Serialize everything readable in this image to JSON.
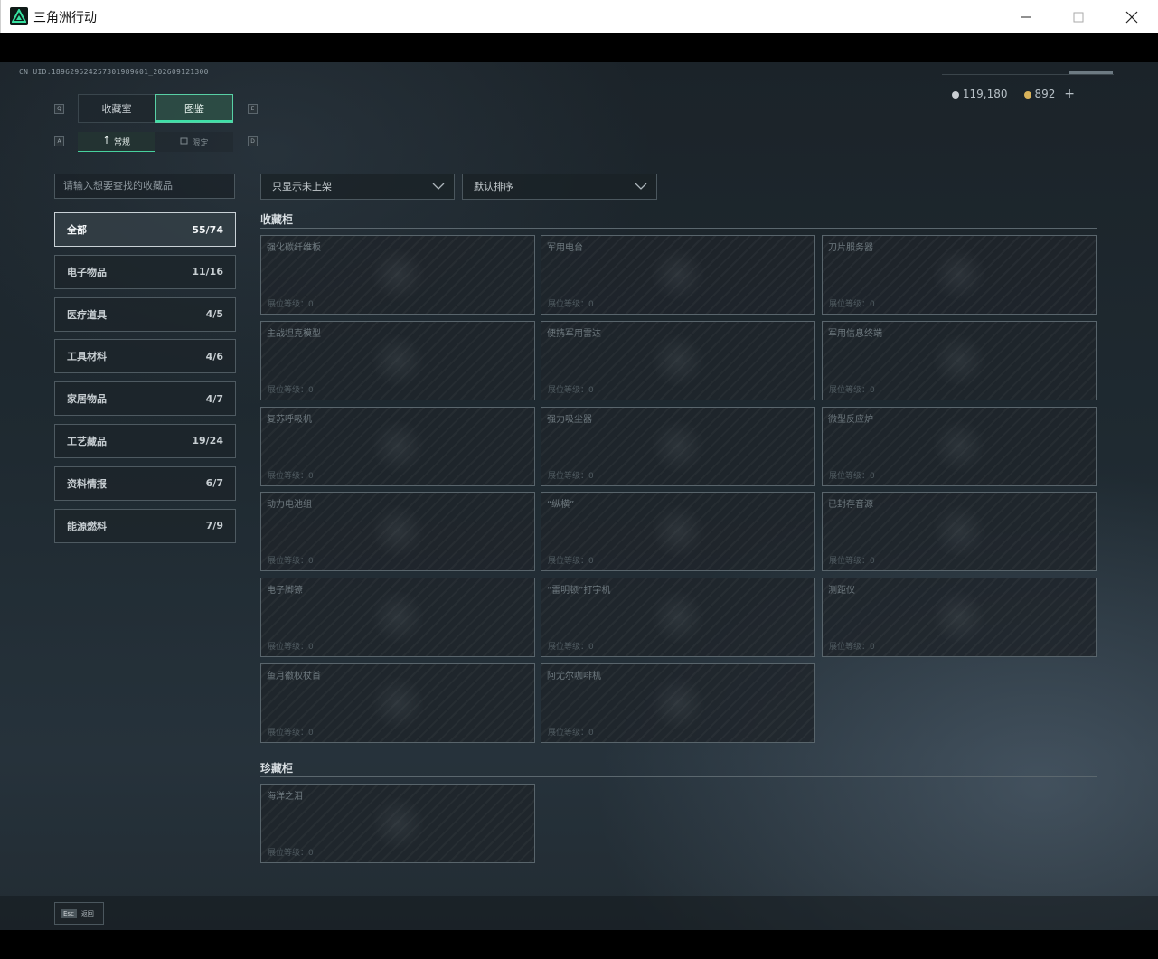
{
  "window": {
    "title": "三角洲行动"
  },
  "uid_text": "CN UID:189629524257301989601_202609121300",
  "main_tabs": [
    {
      "label": "收藏室",
      "key": "Q",
      "active": false
    },
    {
      "label": "图鉴",
      "key": "E",
      "active": true
    }
  ],
  "sub_tabs": [
    {
      "label": "常规",
      "key": "A",
      "active": true
    },
    {
      "label": "限定",
      "key": "D",
      "active": false
    }
  ],
  "currency": {
    "coins": "119,180",
    "tokens": "892",
    "add": "+"
  },
  "search": {
    "placeholder": "请输入想要查找的收藏品"
  },
  "categories": [
    {
      "name": "全部",
      "count": "55/74",
      "active": true
    },
    {
      "name": "电子物品",
      "count": "11/16"
    },
    {
      "name": "医疗道具",
      "count": "4/5"
    },
    {
      "name": "工具材料",
      "count": "4/6"
    },
    {
      "name": "家居物品",
      "count": "4/7"
    },
    {
      "name": "工艺藏品",
      "count": "19/24"
    },
    {
      "name": "资料情报",
      "count": "6/7"
    },
    {
      "name": "能源燃料",
      "count": "7/9"
    }
  ],
  "filters": {
    "show_filter": "只显示未上架",
    "sort": "默认排序"
  },
  "sections": [
    {
      "title": "收藏柜",
      "items": [
        {
          "name": "强化碳纤维板",
          "level": "展位等级：0"
        },
        {
          "name": "军用电台",
          "level": "展位等级：0"
        },
        {
          "name": "刀片服务器",
          "level": "展位等级：0"
        },
        {
          "name": "主战坦克模型",
          "level": "展位等级：0"
        },
        {
          "name": "便携军用雷达",
          "level": "展位等级：0"
        },
        {
          "name": "军用信息终端",
          "level": "展位等级：0"
        },
        {
          "name": "复苏呼吸机",
          "level": "展位等级：0"
        },
        {
          "name": "强力吸尘器",
          "level": "展位等级：0"
        },
        {
          "name": "微型反应炉",
          "level": "展位等级：0"
        },
        {
          "name": "动力电池组",
          "level": "展位等级：0"
        },
        {
          "name": "“纵横”",
          "level": "展位等级：0"
        },
        {
          "name": "已封存音源",
          "level": "展位等级：0"
        },
        {
          "name": "电子脚镣",
          "level": "展位等级：0"
        },
        {
          "name": "“雷明顿”打字机",
          "level": "展位等级：0"
        },
        {
          "name": "测距仪",
          "level": "展位等级：0"
        },
        {
          "name": "鱼月徽权杖首",
          "level": "展位等级：0"
        },
        {
          "name": "阿尤尔咖啡机",
          "level": "展位等级：0"
        }
      ]
    },
    {
      "title": "珍藏柜",
      "items": [
        {
          "name": "海洋之泪",
          "level": "展位等级：0"
        }
      ]
    }
  ],
  "footer": {
    "esc_key": "Esc",
    "esc_label": "返回"
  },
  "colors": {
    "accent": "#3fe0a8",
    "coin": "#c9ced2",
    "token": "#d8b25a"
  }
}
